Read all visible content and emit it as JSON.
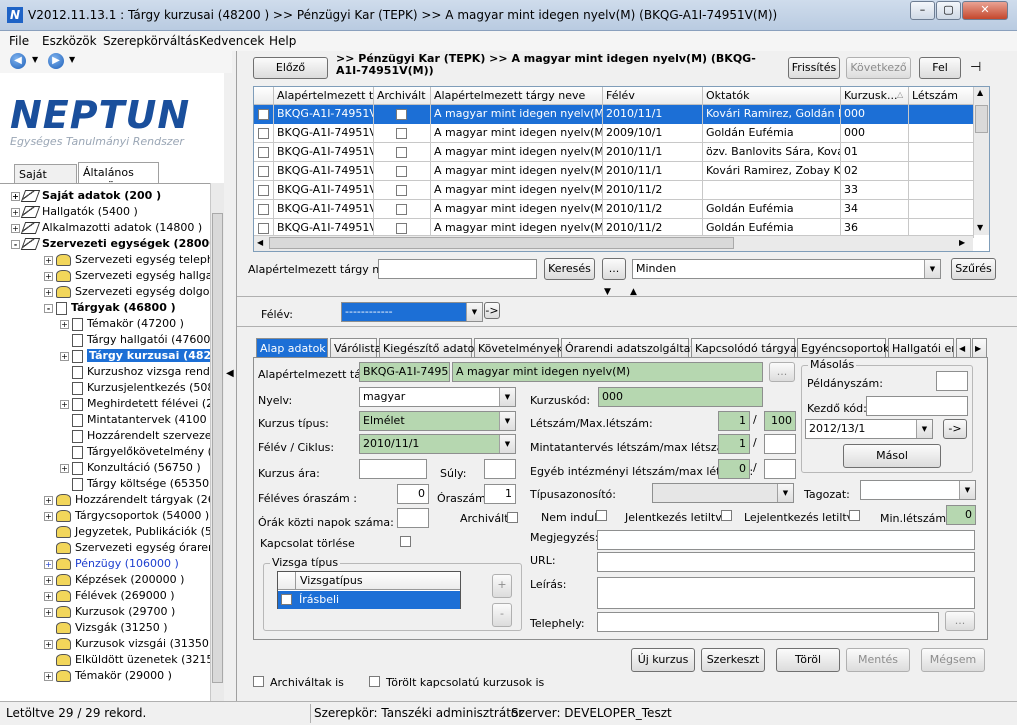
{
  "window": {
    "title": "V2012.11.13.1 : Tárgy kurzusai (48200 ) >> Pénzügyi Kar (TEPK) >> A magyar mint idegen nyelv(M) (BKQG-A1I-74951V(M))",
    "icon_letter": "N"
  },
  "menu": [
    "File",
    "Eszközök",
    "Szerepkörváltás",
    "Kedvencek",
    "Help"
  ],
  "logo": {
    "name": "NEPTUN",
    "tagline": "Egységes Tanulmányi Rendszer"
  },
  "left_tabs": [
    "Saját menü",
    "Általános menü"
  ],
  "tree": [
    {
      "label": "Saját adatok (200  )",
      "level": 0,
      "bold": true,
      "exp": "+"
    },
    {
      "label": "Hallgatók (5400  )",
      "level": 0,
      "exp": "+"
    },
    {
      "label": "Alkalmazotti adatok (14800  )",
      "level": 0,
      "exp": "+"
    },
    {
      "label": "Szervezeti egységek (28000",
      "level": 0,
      "bold": true,
      "exp": "-"
    },
    {
      "label": "Szervezeti egység telephelyei",
      "level": 1,
      "exp": "+"
    },
    {
      "label": "Szervezeti egység hallgatói (2",
      "level": 1,
      "exp": "+"
    },
    {
      "label": "Szervezeti egység dolgozói (2",
      "level": 1,
      "exp": "+"
    },
    {
      "label": "Tárgyak (46800  )",
      "level": 1,
      "bold": true,
      "exp": "-"
    },
    {
      "label": "Témakör (47200  )",
      "level": 2,
      "exp": "+"
    },
    {
      "label": "Tárgy hallgatói (47600  )",
      "level": 2,
      "exp": ""
    },
    {
      "label": "Tárgy kurzusai (4820",
      "level": 2,
      "sel": true,
      "exp": "+"
    },
    {
      "label": "Kurzushoz vizsga rendelé",
      "level": 2,
      "exp": ""
    },
    {
      "label": "Kurzusjelentkezés (50800",
      "level": 2,
      "exp": ""
    },
    {
      "label": "Meghirdetett félévei (2684",
      "level": 2,
      "exp": "+"
    },
    {
      "label": "Mintatantervek (4100  )",
      "level": 2,
      "exp": ""
    },
    {
      "label": "Hozzárendelt szervezeti e",
      "level": 2,
      "exp": ""
    },
    {
      "label": "Tárgyelőkövetelmény (50",
      "level": 2,
      "exp": ""
    },
    {
      "label": "Konzultáció (56750  )",
      "level": 2,
      "exp": "+"
    },
    {
      "label": "Tárgy költsége (65350  )",
      "level": 2,
      "exp": ""
    },
    {
      "label": "Hozzárendelt tárgyak (2650  )",
      "level": 1,
      "exp": "+"
    },
    {
      "label": "Tárgycsoportok (54000  )",
      "level": 1,
      "exp": "+"
    },
    {
      "label": "Jegyzetek, Publikációk (5440",
      "level": 1,
      "exp": ""
    },
    {
      "label": "Szervezeti egység órarendje (",
      "level": 1,
      "exp": ""
    },
    {
      "label": "Pénzügy (106000  )",
      "level": 1,
      "blue": true,
      "exp": "+"
    },
    {
      "label": "Képzések (200000  )",
      "level": 1,
      "exp": "+"
    },
    {
      "label": "Félévek (269000  )",
      "level": 1,
      "exp": "+"
    },
    {
      "label": "Kurzusok (29700  )",
      "level": 1,
      "exp": "+"
    },
    {
      "label": "Vizsgák (31250  )",
      "level": 1,
      "exp": ""
    },
    {
      "label": "Kurzusok vizsgái (31350  )",
      "level": 1,
      "exp": "+"
    },
    {
      "label": "Elküldött üzenetek (32150  )",
      "level": 1,
      "exp": ""
    },
    {
      "label": "Témakör (29000  )",
      "level": 1,
      "exp": "+"
    }
  ],
  "toolbar": {
    "prev": "Előző",
    "heading": ">> Pénzügyi Kar (TEPK) >> A magyar mint idegen nyelv(M) (BKQG-A1I-74951V(M))",
    "refresh": "Frissítés",
    "next": "Következő",
    "up": "Fel"
  },
  "grid": {
    "columns": [
      "",
      "Alapértelmezett tá...",
      "Archivált",
      "Alapértelmezett tárgy neve",
      "Félév",
      "Oktatók",
      "Kurzusk...",
      "Létszám"
    ],
    "rows": [
      [
        "BKQG-A1I-74951V(M)",
        "A magyar mint idegen nyelv(M)",
        "2010/11/1",
        "Kovári Ramirez, Goldán Eufémia",
        "000",
        ""
      ],
      [
        "BKQG-A1I-74951V(M)",
        "A magyar mint idegen nyelv(M)",
        "2009/10/1",
        "Goldán Eufémia",
        "000",
        ""
      ],
      [
        "BKQG-A1I-74951V(M)",
        "A magyar mint idegen nyelv(M)",
        "2010/11/1",
        "özv. Banlovits Sára, Kovári R",
        "01",
        ""
      ],
      [
        "BKQG-A1I-74951V(M)",
        "A magyar mint idegen nyelv(M)",
        "2010/11/1",
        "Kovári Ramirez, Zobay Kolos",
        "02",
        ""
      ],
      [
        "BKQG-A1I-74951V(M)",
        "A magyar mint idegen nyelv(M)",
        "2010/11/2",
        "",
        "33",
        ""
      ],
      [
        "BKQG-A1I-74951V(M)",
        "A magyar mint idegen nyelv(M)",
        "2010/11/2",
        "Goldán Eufémia",
        "34",
        ""
      ],
      [
        "BKQG-A1I-74951V(M)",
        "A magyar mint idegen nyelv(M)",
        "2010/11/2",
        "Goldán Eufémia",
        "36",
        ""
      ]
    ]
  },
  "search": {
    "label": "Alapértelmezett tárgy neve",
    "button": "Keresés",
    "dots": "...",
    "filter": "Minden",
    "filter_btn": "Szűrés"
  },
  "semester": {
    "label": "Félév:",
    "value": "------------",
    "go": "->"
  },
  "tabs": [
    "Alap adatok",
    "Várólista",
    "Kiegészítő adatok",
    "Követelmények",
    "Órarendi adatszolgáltatás",
    "Kapcsolódó tárgyak",
    "Egyéncsoportok",
    "Hallgatói ered"
  ],
  "form": {
    "subject_label": "Alapértelmezett tárgy:",
    "subject_code": "BKQG-A1I-74951V",
    "subject_name": "A magyar mint idegen nyelv(M)",
    "language_label": "Nyelv:",
    "language": "magyar",
    "course_type_label": "Kurzus típus:",
    "course_type": "Elmélet",
    "semester_label": "Félév / Ciklus:",
    "semester": "2010/11/1",
    "price_label": "Kurzus ára:",
    "weight_label": "Súly:",
    "hours_label": "Féléves óraszám :",
    "hours": "0",
    "hour_label": "Óraszám:",
    "hour": "1",
    "days_label": "Órák közti napok száma:",
    "archived_label": "Archivált",
    "delete_label": "Kapcsolat törlése",
    "code_label": "Kurzuskód:",
    "code": "000",
    "cap_label": "Létszám/Max.létszám:",
    "cap": "1",
    "cap_max": "100",
    "curr_label": "Mintatantervés létszám/max létszám:",
    "curr": "1",
    "other_label": "Egyéb intézményi létszám/max létszám:",
    "other": "0",
    "typeid_label": "Típusazonosító:",
    "tagozat_label": "Tagozat:",
    "nem_indul": "Nem indul",
    "jel_tiltva": "Jelentkezés letiltva",
    "lejel_tiltva": "Lejelentkezés letiltva",
    "min_label": "Min.létszám:",
    "min": "0",
    "note_label": "Megjegyzés:",
    "url_label": "URL:",
    "desc_label": "Leírás:",
    "site_label": "Telephely:",
    "site_btn": "...",
    "subject_btn": "...",
    "copy_group": "Másolás",
    "copies_label": "Példányszám:",
    "start_label": "Kezdő kód:",
    "copy_sem": "2012/13/1",
    "copy_go": "->",
    "copy_btn": "Másol",
    "exam_group": "Vizsga típus",
    "exam_header": "Vizsgatípus",
    "exam_row": "Írásbeli",
    "plus": "+",
    "minus": "-"
  },
  "actions": [
    "Új kurzus",
    "Szerkeszt",
    "Töröl",
    "Mentés",
    "Mégsem"
  ],
  "bottom": {
    "archived": "Archiváltak is",
    "deleted": "Törölt kapcsolatú kurzusok is"
  },
  "status": {
    "records": "Letöltve 29 / 29 rekord.",
    "role": "Szerepkör: Tanszéki adminisztrátor",
    "server": "Szerver: DEVELOPER_Teszt"
  },
  "colors": {
    "selection": "#1c6fd6",
    "readonly_green": "#b6d7b0",
    "logo_blue": "#1a4f9c"
  }
}
